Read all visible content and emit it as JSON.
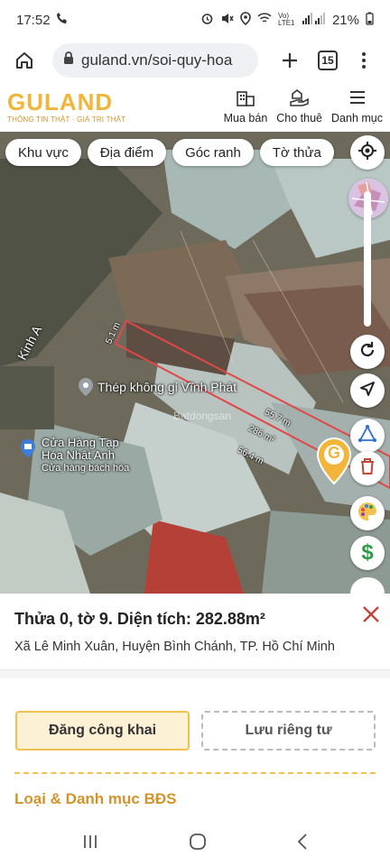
{
  "status_bar": {
    "time": "17:52",
    "battery": "21%",
    "network": "Vo) LTE1"
  },
  "browser": {
    "url": "guland.vn/soi-quy-hoa",
    "tab_count": "15"
  },
  "header": {
    "logo_text": "GULAND",
    "tagline": "THÔNG TIN THẬT · GIÁ TRỊ THẬT",
    "nav": [
      {
        "label": "Mua bán",
        "icon": "building-icon"
      },
      {
        "label": "Cho thuê",
        "icon": "hand-house-icon"
      },
      {
        "label": "Danh mục",
        "icon": "menu-icon"
      }
    ]
  },
  "map": {
    "chips": [
      "Khu vực",
      "Địa điểm",
      "Góc ranh",
      "Tờ thửa"
    ],
    "labels": {
      "street": "Kinh A",
      "poi_1": "Thép không gỉ Vĩnh Phát",
      "poi_2_line1": "Cửa Hàng Tạp",
      "poi_2_line2": "Hóa Nhật Anh",
      "poi_2_sub": "Cửa hàng bách hóa"
    },
    "dimensions": {
      "short_side": "5.1 m",
      "long_side_top": "55.7 m",
      "long_side_bottom": "56.4 m",
      "area": "286 m²"
    },
    "watermark": "Batdongsan",
    "marker_letter": "G"
  },
  "parcel": {
    "title": "Thửa 0, tờ 9. Diện tích: 282.88m²",
    "address": "Xã Lê Minh Xuân, Huyện Bình Chánh, TP. Hồ Chí Minh",
    "btn_public": "Đăng công khai",
    "btn_private": "Lưu riêng tư",
    "section_title": "Loại & Danh mục BĐS"
  },
  "colors": {
    "brand": "#f2b53a",
    "parcel_outline": "#e04848",
    "close": "#c4463a",
    "money": "#2e9b48"
  }
}
